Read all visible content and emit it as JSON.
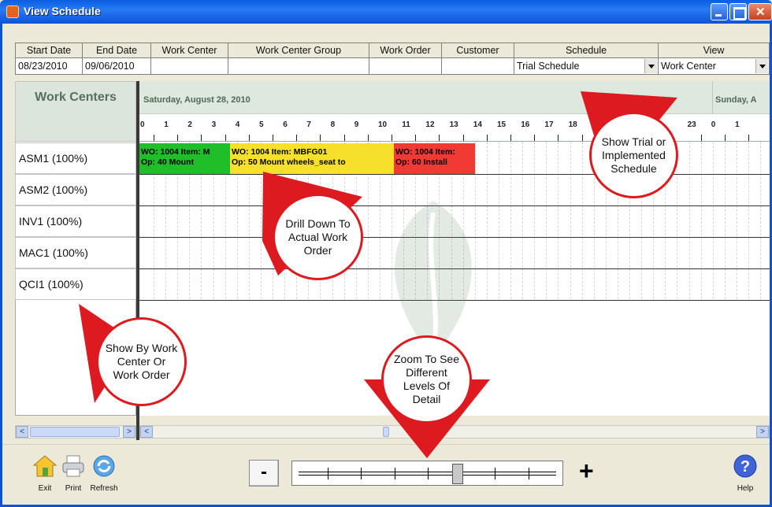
{
  "window": {
    "title": "View Schedule"
  },
  "filters": {
    "headers": [
      "Start Date",
      "End Date",
      "Work Center",
      "Work Center Group",
      "Work Order",
      "Customer",
      "Schedule",
      "View"
    ],
    "values": {
      "start_date": "08/23/2010",
      "end_date": "09/06/2010",
      "work_center": "",
      "work_center_group": "",
      "work_order": "",
      "customer": "",
      "schedule": "Trial Schedule",
      "view": "Work Center"
    }
  },
  "work_centers": {
    "header": "Work Centers",
    "rows": [
      "ASM1  (100%)",
      "ASM2  (100%)",
      "INV1  (100%)",
      "MAC1  (100%)",
      "QCI1  (100%)"
    ]
  },
  "gantt": {
    "dates": [
      "Saturday, August 28, 2010",
      "Sunday, A"
    ],
    "hours_visible": [
      "0",
      "1",
      "2",
      "3",
      "4",
      "5",
      "6",
      "7",
      "8",
      "9",
      "10",
      "11",
      "12",
      "13",
      "14",
      "15",
      "16",
      "17",
      "18",
      "23",
      "0",
      "1"
    ],
    "bars": [
      {
        "line1": "WO: 1004  Item: M",
        "line2": "Op: 40 Mount",
        "color": "#1fbf2a"
      },
      {
        "line1": "WO: 1004  Item: MBFG01",
        "line2": "Op: 50 Mount wheels_seat to",
        "color": "#f7e02a"
      },
      {
        "line1": "WO: 1004  Item:",
        "line2": "Op: 60 Install",
        "color": "#f03a33"
      }
    ]
  },
  "callouts": {
    "schedule": "Show Trial or Implemented Schedule",
    "drill": "Drill Down To Actual Work Order",
    "showby": "Show By Work Center Or Work Order",
    "zoom": "Zoom To See Different Levels Of Detail"
  },
  "toolbar": {
    "exit": "Exit",
    "print": "Print",
    "refresh": "Refresh",
    "help": "Help",
    "zoom_minus": "-",
    "zoom_plus": "+",
    "zoom_level": 0.62
  },
  "colors": {
    "callout_red": "#dd1a1f",
    "title_blue": "#0b54d8"
  }
}
